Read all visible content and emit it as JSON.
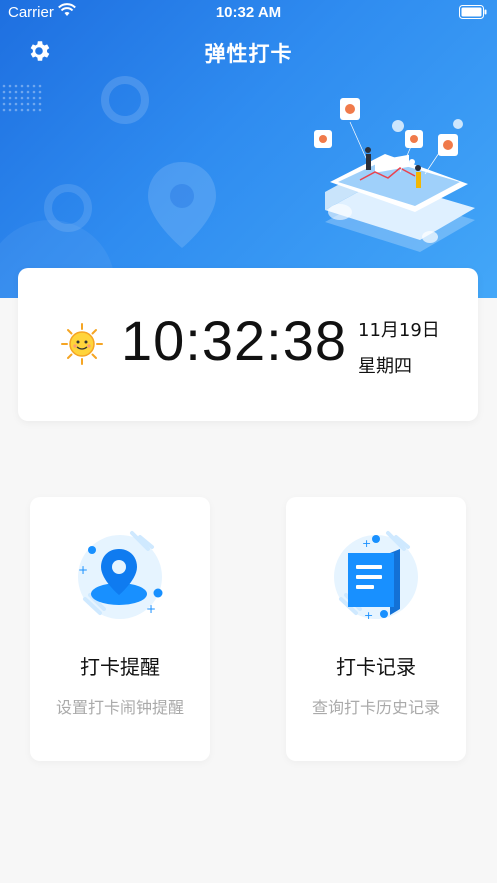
{
  "status_bar": {
    "carrier": "Carrier",
    "time": "10:32 AM"
  },
  "nav": {
    "title": "弹性打卡",
    "settings_icon": "gear-icon"
  },
  "clock": {
    "time": "10:32:38",
    "date": "11月19日",
    "weekday": "星期四",
    "weather_icon": "sun-icon"
  },
  "cards": [
    {
      "title": "打卡提醒",
      "subtitle": "设置打卡闹钟提醒",
      "icon": "location-pin-icon"
    },
    {
      "title": "打卡记录",
      "subtitle": "查询打卡历史记录",
      "icon": "document-list-icon"
    }
  ],
  "colors": {
    "hero_start": "#1e6fe0",
    "hero_end": "#43a7f8",
    "accent": "#1890ff",
    "sun": "#ffd43b"
  }
}
